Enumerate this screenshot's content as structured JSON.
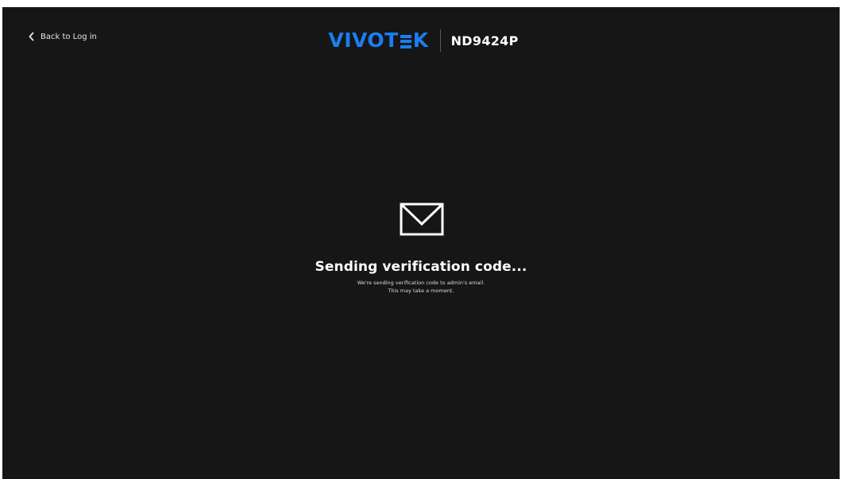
{
  "nav": {
    "back_label": "Back to Log in"
  },
  "header": {
    "brand": "VIVOTEK",
    "brand_parts": [
      "VIVOT",
      "K"
    ],
    "model": "ND9424P"
  },
  "status": {
    "icon": "mail-icon",
    "title": "Sending verification code...",
    "line1": "We're sending verification code to admin's email.",
    "line2": "This may take a moment."
  },
  "colors": {
    "background": "#161616",
    "brand": "#1b7ef3",
    "text": "#ffffff"
  }
}
